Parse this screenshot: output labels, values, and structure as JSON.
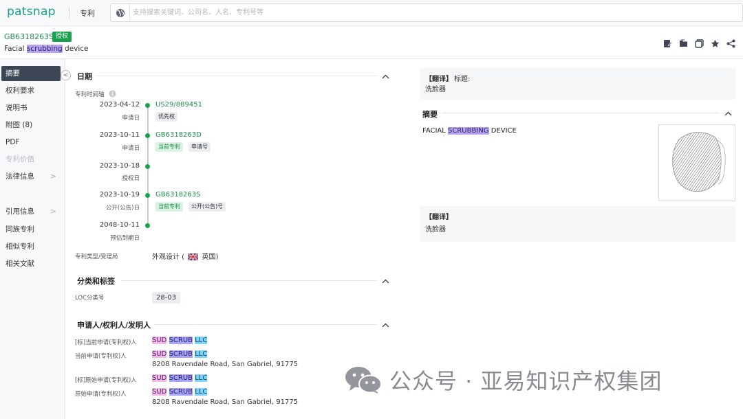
{
  "topbar": {
    "logo_text": "patsnap",
    "nav_label": "专利",
    "search_placeholder": "支持搜索关键词、公司名、人名、专利号等",
    "globe_icon": "globe-icon"
  },
  "header": {
    "patent_number": "GB6318263S",
    "status_badge": "授权",
    "title_before": "Facial ",
    "title_highlight": "scrubbing",
    "title_after": " device",
    "actions": [
      "edit-note-icon",
      "folder-icon",
      "copy-icon",
      "star-icon",
      "share-icon"
    ]
  },
  "sidebar": {
    "items": [
      {
        "label": "摘要",
        "active": true
      },
      {
        "label": "权利要求"
      },
      {
        "label": "说明书"
      },
      {
        "label": "附图 (8)"
      },
      {
        "label": "PDF"
      },
      {
        "label": "专利价值",
        "disabled": true
      },
      {
        "label": "法律信息",
        "chevron": ">"
      },
      {
        "label": "引用信息",
        "chevron": ">"
      },
      {
        "label": "同族专利"
      },
      {
        "label": "相似专利"
      },
      {
        "label": "相关文献"
      }
    ],
    "collapse_symbol": "<"
  },
  "dates_section": {
    "title": "日期",
    "timeline_label": "专利时间轴",
    "timeline": [
      {
        "date": "2023-04-12",
        "kind": "申请日",
        "number": "US29/889451",
        "tags": [
          "优先权"
        ]
      },
      {
        "date": "2023-10-11",
        "kind": "申请日",
        "number": "GB6318263D",
        "tags": [
          "当前专利",
          "申请号"
        ]
      },
      {
        "date": "2023-10-18",
        "kind": "授权日",
        "number": "",
        "tags": []
      },
      {
        "date": "2023-10-19",
        "kind": "公开(公告)日",
        "number": "GB6318263S",
        "tags": [
          "当前专利",
          "公开(公告)号"
        ]
      },
      {
        "date": "2048-10-11",
        "kind": "预估到期日",
        "number": "",
        "tags": []
      }
    ],
    "type_label": "专利类型/受理局",
    "type_value": "外观设计 (",
    "country": "英国)"
  },
  "classification": {
    "title": "分类和标签",
    "loc_label": "LOC分类号",
    "loc_value": "28-03"
  },
  "applicants": {
    "title": "申请人/权利人/发明人",
    "name_parts": [
      "SUD",
      "SCRUB",
      "LLC"
    ],
    "rows": [
      {
        "label": "[标]当前申请(专利权)人",
        "address": ""
      },
      {
        "label": "当前申请(专利权)人",
        "address": "8208 Ravendale Road, San Gabriel, 91775"
      },
      {
        "label": "[标]原始申请(专利权)人",
        "address": ""
      },
      {
        "label": "原始申请(专利权)人",
        "address": "8208 Ravendale Road, San Gabriel, 91775"
      }
    ]
  },
  "right": {
    "translate_title_head": "【翻译】",
    "translate_title_label": "标题:",
    "translate_title_value": "洗脸器",
    "abstract_title": "摘要",
    "abstract_before": "FACIAL ",
    "abstract_highlight": "SCRUBBING",
    "abstract_after": " DEVICE",
    "translate_abs_head": "【翻译】",
    "translate_abs_value": "洗脸器"
  },
  "watermark": {
    "text": "公众号 · 亚易知识产权集团"
  },
  "colors": {
    "brand": "#16a085",
    "granted": "#1aa04b",
    "sidebar_active": "#3c4654"
  }
}
